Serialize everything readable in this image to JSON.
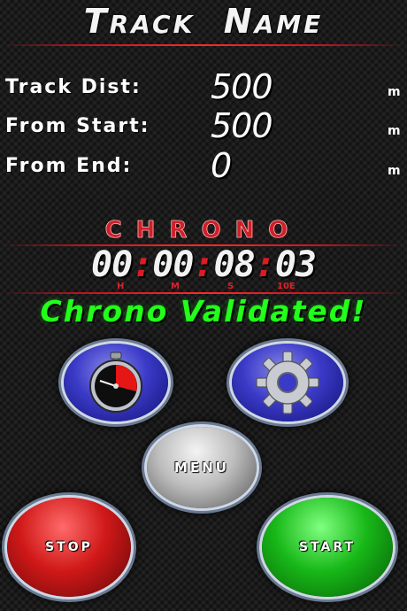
{
  "header": {
    "title_cap_1": "T",
    "title_rest_1": "RACK",
    "title_cap_2": "N",
    "title_rest_2": "AME"
  },
  "stats": {
    "track_dist": {
      "label": "Track Dist:",
      "value": "500",
      "unit": "m"
    },
    "from_start": {
      "label": "From Start:",
      "value": "500",
      "unit": "m"
    },
    "from_end": {
      "label": "From End:",
      "value": "0",
      "unit": "m"
    }
  },
  "chrono": {
    "title": "CHRONO",
    "hours": "00",
    "minutes": "00",
    "seconds": "08",
    "tenths": "03",
    "units": {
      "h": "H",
      "m": "M",
      "s": "S",
      "t": "10E"
    }
  },
  "status_text": "Chrono Validated!",
  "buttons": {
    "menu": "Menu",
    "stop": "stop",
    "start": "start"
  },
  "icons": {
    "chrono_button": "stopwatch-icon",
    "settings_button": "gear-icon"
  },
  "colors": {
    "accent_red": "#d21e28",
    "status_green": "#22ff1a",
    "button_blue": "#3a3ac8"
  }
}
